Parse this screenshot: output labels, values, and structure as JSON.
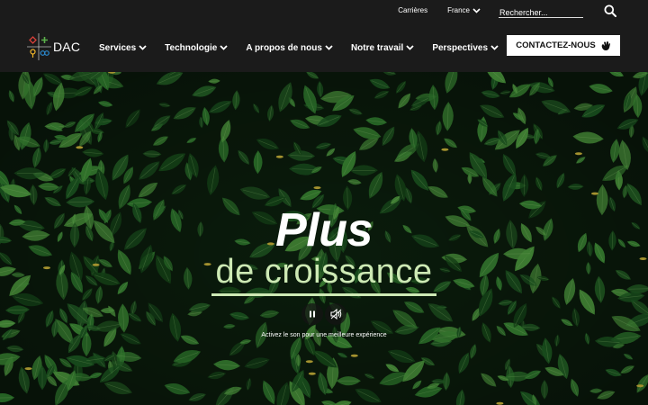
{
  "utility": {
    "careers": "Carrières",
    "language": "France",
    "search_placeholder": "Rechercher..."
  },
  "brand": {
    "name": "DAC"
  },
  "nav": {
    "items": [
      {
        "label": "Services"
      },
      {
        "label": "Technologie"
      },
      {
        "label": "A propos de nous"
      },
      {
        "label": "Notre travail"
      },
      {
        "label": "Perspectives"
      }
    ]
  },
  "cta": {
    "label": "CONTACTEZ-NOUS"
  },
  "hero": {
    "title_line1": "Plus",
    "title_line2": "de croissance",
    "sound_note": "Activez le son pour une meilleure expérience"
  },
  "colors": {
    "header_bg": "#1b1b1b",
    "accent_green": "#cde9b4",
    "leaf_dark": "#1d5a22",
    "leaf_mid": "#2f7a2e",
    "leaf_light": "#4d9a3e",
    "logo_red": "#d9413a",
    "logo_green": "#5bb04a",
    "logo_yellow": "#f0b429",
    "logo_blue": "#2b8bd1"
  },
  "icons": {
    "search": "search-icon",
    "chevron": "chevron-down-icon",
    "hand": "hand-wave-icon",
    "pause": "pause-icon",
    "mute": "speaker-muted-icon"
  }
}
